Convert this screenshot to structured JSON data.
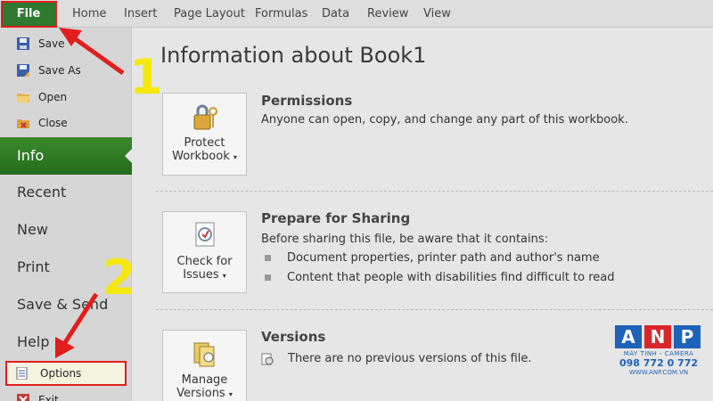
{
  "ribbon": {
    "file_tab": "File",
    "tabs": [
      "Home",
      "Insert",
      "Page Layout",
      "Formulas",
      "Data",
      "Review",
      "View"
    ]
  },
  "nav": {
    "small_items": [
      {
        "label": "Save",
        "icon": "save-icon"
      },
      {
        "label": "Save As",
        "icon": "save-as-icon"
      },
      {
        "label": "Open",
        "icon": "open-folder-icon"
      },
      {
        "label": "Close",
        "icon": "close-file-icon"
      }
    ],
    "info": "Info",
    "recent": "Recent",
    "new": "New",
    "print": "Print",
    "save_send": "Save & Send",
    "help": "Help",
    "options": "Options",
    "exit": "Exit"
  },
  "main": {
    "title": "Information about Book1",
    "permissions": {
      "button_line1": "Protect",
      "button_line2": "Workbook",
      "title": "Permissions",
      "desc": "Anyone can open, copy, and change any part of this workbook."
    },
    "sharing": {
      "button_line1": "Check for",
      "button_line2": "Issues",
      "title": "Prepare for Sharing",
      "desc": "Before sharing this file, be aware that it contains:",
      "bullets": [
        "Document properties, printer path and author's name",
        "Content that people with disabilities find difficult to read"
      ]
    },
    "versions": {
      "button_line1": "Manage",
      "button_line2": "Versions",
      "title": "Versions",
      "desc": "There are no previous versions of this file."
    }
  },
  "annotations": {
    "step1": "1",
    "step2": "2",
    "highlight_color": "#e21d1d",
    "number_color": "#f5e80f"
  },
  "watermark": {
    "letters": [
      "A",
      "N",
      "P"
    ],
    "subtitle": "MÁY TÍNH - CAMERA",
    "phone": "098 772 0 772",
    "url": "WWW.ANP.COM.VN"
  },
  "colors": {
    "file_tab": "#2f7a2f",
    "info_active": "#2e7a23",
    "background": "#e6e6e6"
  }
}
